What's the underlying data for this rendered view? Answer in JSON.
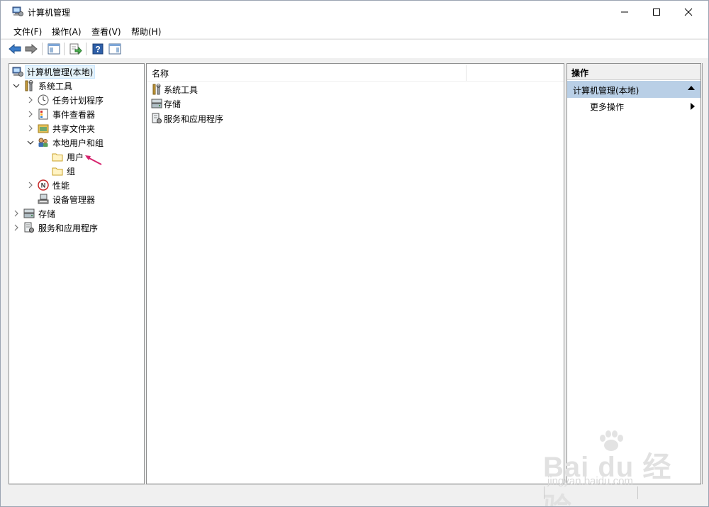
{
  "window": {
    "title": "计算机管理"
  },
  "menubar": {
    "items": [
      {
        "label": "文件(F)"
      },
      {
        "label": "操作(A)"
      },
      {
        "label": "查看(V)"
      },
      {
        "label": "帮助(H)"
      }
    ]
  },
  "toolbar": {
    "buttons": [
      "back-icon",
      "forward-icon",
      "show-hide-tree-icon",
      "export-list-icon",
      "help-icon",
      "show-hide-action-pane-icon"
    ]
  },
  "tree": {
    "root": {
      "label": "计算机管理(本地)"
    },
    "system_tools": {
      "label": "系统工具"
    },
    "task_scheduler": {
      "label": "任务计划程序"
    },
    "event_viewer": {
      "label": "事件查看器"
    },
    "shared_folders": {
      "label": "共享文件夹"
    },
    "local_users_groups": {
      "label": "本地用户和组"
    },
    "users": {
      "label": "用户"
    },
    "groups": {
      "label": "组"
    },
    "performance": {
      "label": "性能"
    },
    "device_manager": {
      "label": "设备管理器"
    },
    "storage": {
      "label": "存储"
    },
    "services_apps": {
      "label": "服务和应用程序"
    }
  },
  "list": {
    "column_name": "名称",
    "rows": [
      {
        "label": "系统工具"
      },
      {
        "label": "存储"
      },
      {
        "label": "服务和应用程序"
      }
    ]
  },
  "actions": {
    "title": "操作",
    "group_label": "计算机管理(本地)",
    "more_actions": "更多操作"
  },
  "watermark": {
    "logo_text": "Bai du 经验",
    "url": "jingyan.baidu.com"
  },
  "colors": {
    "selection": "#e5f3fb",
    "action_group_bg": "#b9cfe6",
    "annotation_arrow": "#d6246e"
  }
}
